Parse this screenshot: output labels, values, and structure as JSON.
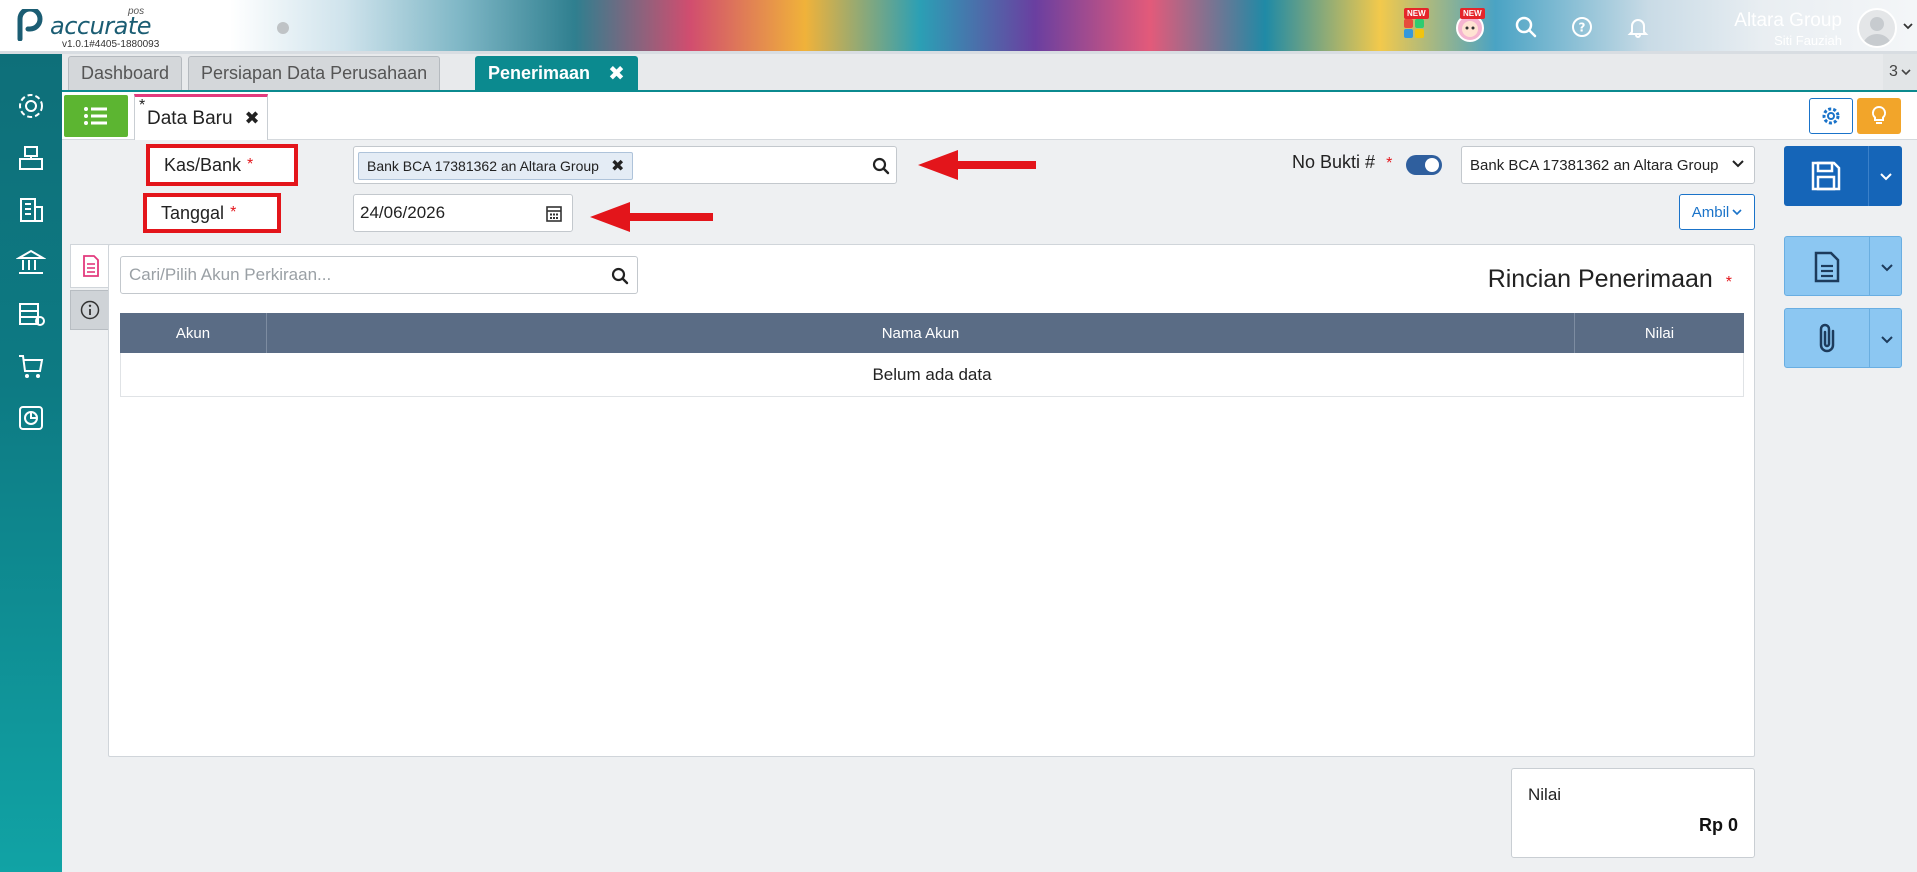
{
  "app": {
    "logo_text": "accurate",
    "logo_sub": "pos",
    "version": "v1.0.1#4405-1880093",
    "company": "Altara Group",
    "user": "Siti Fauziah",
    "badge_new": "NEW"
  },
  "tabs": [
    {
      "label": "Dashboard"
    },
    {
      "label": "Persiapan Data Perusahaan"
    },
    {
      "label": "Penerimaan"
    }
  ],
  "tab_count": "3",
  "doc_tab": {
    "star": "*",
    "label": "Data Baru"
  },
  "form": {
    "kas_label": "Kas/Bank",
    "kas_value": "Bank BCA 17381362 an Altara Group",
    "tanggal_label": "Tanggal",
    "tanggal_value": "24/06/2026",
    "required_mark": "*",
    "no_bukti_label": "No Bukti #",
    "no_bukti_select": "Bank BCA 17381362 an Altara Group",
    "ambil_label": "Ambil"
  },
  "panel": {
    "search_placeholder": "Cari/Pilih Akun Perkiraan...",
    "title": "Rincian Penerimaan",
    "columns": [
      "Akun",
      "Nama Akun",
      "Nilai"
    ],
    "empty_text": "Belum ada data"
  },
  "total": {
    "label": "Nilai",
    "value": "Rp 0"
  },
  "colors": {
    "sidebar": "#0e6f79",
    "accent": "#0b8a8f",
    "primary": "#1565b8",
    "highlight": "#e3151b",
    "list_button": "#5cb531"
  }
}
